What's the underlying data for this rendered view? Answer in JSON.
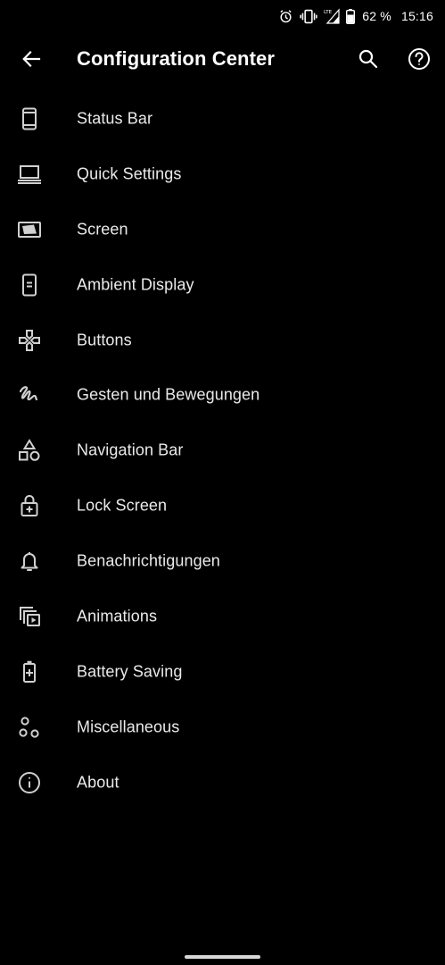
{
  "status_bar": {
    "battery_percent": "62 %",
    "clock": "15:16",
    "icons": [
      "alarm-icon",
      "vibrate-icon",
      "lte-signal-icon",
      "battery-icon"
    ]
  },
  "app_bar": {
    "title": "Configuration Center",
    "icons": [
      "back-arrow-icon",
      "search-icon",
      "help-icon"
    ]
  },
  "menu": {
    "items": [
      {
        "label": "Status Bar",
        "icon": "phone-outline-icon"
      },
      {
        "label": "Quick Settings",
        "icon": "laptop-icon"
      },
      {
        "label": "Screen",
        "icon": "screen-icon"
      },
      {
        "label": "Ambient Display",
        "icon": "ambient-phone-icon"
      },
      {
        "label": "Buttons",
        "icon": "gamepad-icon"
      },
      {
        "label": "Gesten und Bewegungen",
        "icon": "gesture-icon"
      },
      {
        "label": "Navigation Bar",
        "icon": "shapes-icon"
      },
      {
        "label": "Lock Screen",
        "icon": "lock-plus-icon"
      },
      {
        "label": "Benachrichtigungen",
        "icon": "bell-icon"
      },
      {
        "label": "Animations",
        "icon": "animation-icon"
      },
      {
        "label": "Battery Saving",
        "icon": "battery-plus-icon"
      },
      {
        "label": "Miscellaneous",
        "icon": "bubbles-icon"
      },
      {
        "label": "About",
        "icon": "info-icon"
      }
    ]
  },
  "colors": {
    "background": "#000000",
    "text": "#eaeaea",
    "icon": "#d0d0d0"
  }
}
